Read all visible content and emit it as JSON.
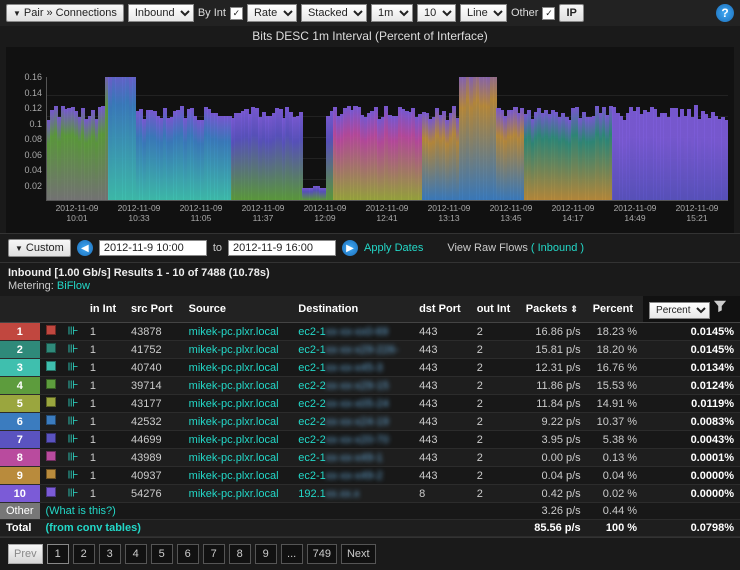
{
  "toolbar": {
    "pair_label": "Pair »",
    "connections_label": "Connections",
    "direction": "Inbound",
    "byint_label": "By Int",
    "byint_checked": true,
    "rate": "Rate",
    "stacked": "Stacked",
    "interval": "1m",
    "count": "10",
    "viz": "Line",
    "other_label": "Other",
    "other_checked": true,
    "ip_label": "IP"
  },
  "chart": {
    "title": "Bits DESC 1m Interval (Percent of Interface)"
  },
  "chart_data": {
    "type": "area",
    "title": "Bits DESC 1m Interval (Percent of Interface)",
    "xlabel": "",
    "ylabel": "",
    "ylim": [
      0,
      0.16
    ],
    "y_ticks": [
      0.02,
      0.04,
      0.06,
      0.08,
      0.1,
      0.12,
      0.14,
      0.16
    ],
    "x_ticks": [
      {
        "date": "2012-11-09",
        "time": "10:01"
      },
      {
        "date": "2012-11-09",
        "time": "10:33"
      },
      {
        "date": "2012-11-09",
        "time": "11:05"
      },
      {
        "date": "2012-11-09",
        "time": "11:37"
      },
      {
        "date": "2012-11-09",
        "time": "12:09"
      },
      {
        "date": "2012-11-09",
        "time": "12:41"
      },
      {
        "date": "2012-11-09",
        "time": "13:13"
      },
      {
        "date": "2012-11-09",
        "time": "13:45"
      },
      {
        "date": "2012-11-09",
        "time": "14:17"
      },
      {
        "date": "2012-11-09",
        "time": "14:49"
      },
      {
        "date": "2012-11-09",
        "time": "15:21"
      }
    ],
    "series_colors": [
      "#c1473f",
      "#2f8a7a",
      "#3fbfae",
      "#5d9c3d",
      "#9aa63e",
      "#3b7cbf",
      "#5a53c0",
      "#b94b9e",
      "#b98b3c",
      "#7b5bd7",
      "#777"
    ],
    "note": "Stacked area of 10 connection series + Other; total envelope ~0.10–0.12 with spikes to ~0.16 near 10:33 and 13:45, dip near-zero around 12:09."
  },
  "datebar": {
    "custom_label": "Custom",
    "from": "2012-11-9 10:00",
    "to_label": "to",
    "to": "2012-11-9 16:00",
    "apply": "Apply Dates",
    "view_raw": "View Raw Flows",
    "view_raw_paren": "( Inbound )"
  },
  "results": {
    "header": "Inbound [1.00 Gb/s] Results 1 - 10 of 7488 (10.78s)",
    "metering_label": "Metering:",
    "metering_value": "BiFlow"
  },
  "table": {
    "columns": {
      "in_int": "in Int",
      "src_port": "src Port",
      "source": "Source",
      "destination": "Destination",
      "dst_port": "dst Port",
      "out_int": "out Int",
      "packets": "Packets",
      "percent": "Percent",
      "percent_select": "Percent"
    },
    "rows": [
      {
        "n": "1",
        "color": "#c1473f",
        "in_int": "1",
        "src_port": "43878",
        "source": "mikek-pc.plxr.local",
        "dest": "ec2-1xx-xx-xx0-69",
        "dst_port": "443",
        "out_int": "2",
        "packets": "16.86 p/s",
        "percent": "18.23 %",
        "pct2": "0.0145%"
      },
      {
        "n": "2",
        "color": "#2f8a7a",
        "in_int": "1",
        "src_port": "41752",
        "source": "mikek-pc.plxr.local",
        "dest": "ec2-1xx-xx-x29-226-",
        "dst_port": "443",
        "out_int": "2",
        "packets": "15.81 p/s",
        "percent": "18.20 %",
        "pct2": "0.0145%"
      },
      {
        "n": "3",
        "color": "#3fbfae",
        "in_int": "1",
        "src_port": "40740",
        "source": "mikek-pc.plxr.local",
        "dest": "ec2-1xx-xx-x45-3",
        "dst_port": "443",
        "out_int": "2",
        "packets": "12.31 p/s",
        "percent": "16.76 %",
        "pct2": "0.0134%"
      },
      {
        "n": "4",
        "color": "#5d9c3d",
        "in_int": "1",
        "src_port": "39714",
        "source": "mikek-pc.plxr.local",
        "dest": "ec2-2xx-xx-x29-15",
        "dst_port": "443",
        "out_int": "2",
        "packets": "11.86 p/s",
        "percent": "15.53 %",
        "pct2": "0.0124%"
      },
      {
        "n": "5",
        "color": "#9aa63e",
        "in_int": "1",
        "src_port": "43177",
        "source": "mikek-pc.plxr.local",
        "dest": "ec2-2xx-xx-x05-24",
        "dst_port": "443",
        "out_int": "2",
        "packets": "11.84 p/s",
        "percent": "14.91 %",
        "pct2": "0.0119%"
      },
      {
        "n": "6",
        "color": "#3b7cbf",
        "in_int": "1",
        "src_port": "42532",
        "source": "mikek-pc.plxr.local",
        "dest": "ec2-2xx-xx-x24-19",
        "dst_port": "443",
        "out_int": "2",
        "packets": "9.22 p/s",
        "percent": "10.37 %",
        "pct2": "0.0083%"
      },
      {
        "n": "7",
        "color": "#5a53c0",
        "in_int": "1",
        "src_port": "44699",
        "source": "mikek-pc.plxr.local",
        "dest": "ec2-2xx-xx-x20-70",
        "dst_port": "443",
        "out_int": "2",
        "packets": "3.95 p/s",
        "percent": "5.38 %",
        "pct2": "0.0043%"
      },
      {
        "n": "8",
        "color": "#b94b9e",
        "in_int": "1",
        "src_port": "43989",
        "source": "mikek-pc.plxr.local",
        "dest": "ec2-1xx-xx-x49-1",
        "dst_port": "443",
        "out_int": "2",
        "packets": "0.00 p/s",
        "percent": "0.13 %",
        "pct2": "0.0001%"
      },
      {
        "n": "9",
        "color": "#b98b3c",
        "in_int": "1",
        "src_port": "40937",
        "source": "mikek-pc.plxr.local",
        "dest": "ec2-1xx-xx-x49-2",
        "dst_port": "443",
        "out_int": "2",
        "packets": "0.04 p/s",
        "percent": "0.04 %",
        "pct2": "0.0000%"
      },
      {
        "n": "10",
        "color": "#7b5bd7",
        "in_int": "1",
        "src_port": "54276",
        "source": "mikek-pc.plxr.local",
        "dest": "192.1xx.xx.x",
        "dst_port": "8",
        "out_int": "2",
        "packets": "0.42 p/s",
        "percent": "0.02 %",
        "pct2": "0.0000%"
      }
    ],
    "other": {
      "label": "Other",
      "what": "(What is this?)",
      "packets": "3.26 p/s",
      "percent": "0.44 %",
      "pct2": ""
    },
    "total": {
      "label": "Total",
      "conv": "(from conv tables)",
      "packets": "85.56 p/s",
      "percent": "100 %",
      "pct2": "0.0798%"
    }
  },
  "pager": {
    "prev": "Prev",
    "next": "Next",
    "ellipsis": "...",
    "pages": [
      "1",
      "2",
      "3",
      "4",
      "5",
      "6",
      "7",
      "8",
      "9"
    ],
    "last": "749"
  }
}
